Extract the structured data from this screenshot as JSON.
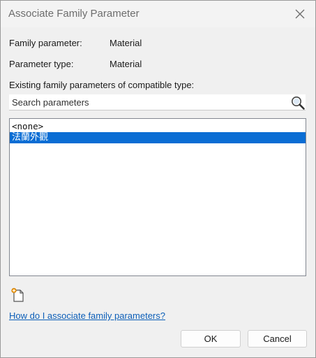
{
  "window": {
    "title": "Associate Family Parameter",
    "close_icon": "close-icon"
  },
  "family_parameter": {
    "label": "Family parameter:",
    "value": "Material"
  },
  "parameter_type": {
    "label": "Parameter type:",
    "value": "Material"
  },
  "existing_params": {
    "heading": "Existing family parameters of compatible type:"
  },
  "search": {
    "placeholder": "Search parameters",
    "value": "",
    "icon": "search-icon"
  },
  "list": {
    "items": [
      {
        "label": "<none>",
        "selected": false
      },
      {
        "label": "法蘭外觀",
        "selected": true
      }
    ],
    "selected_color": "#0a6dd4"
  },
  "new_parameter": {
    "icon": "new-parameter-icon"
  },
  "help": {
    "link_text": "How do I associate family parameters?"
  },
  "buttons": {
    "ok_label": "OK",
    "cancel_label": "Cancel"
  }
}
